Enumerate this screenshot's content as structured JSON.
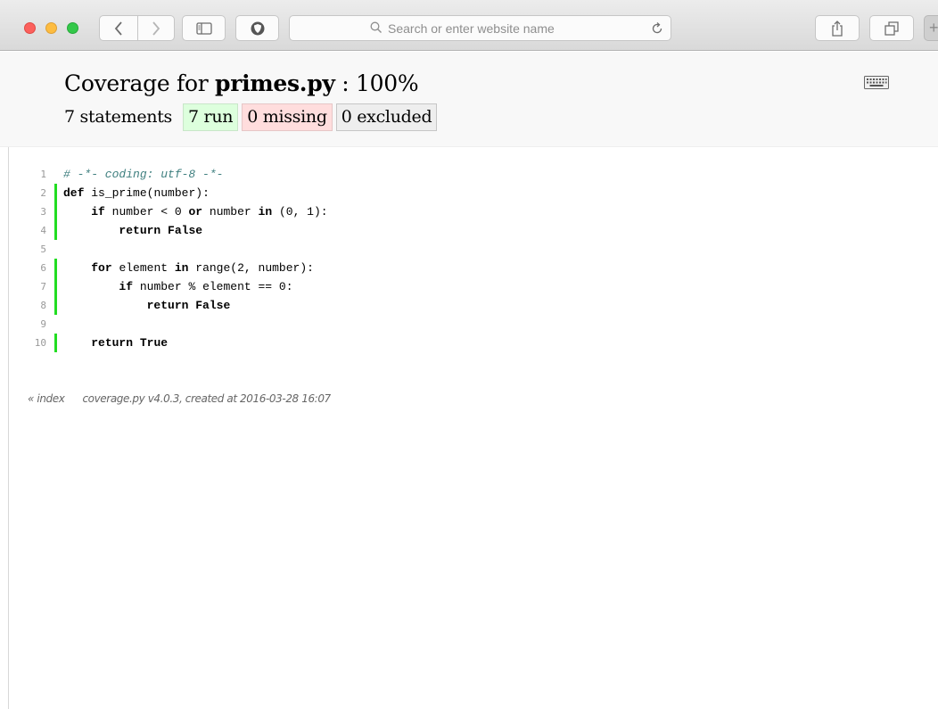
{
  "browser": {
    "address_placeholder": "Search or enter website name",
    "icons": {
      "back": "chevron-left-icon",
      "forward": "chevron-right-icon",
      "sidebar": "sidebar-icon",
      "shield": "shield-icon",
      "search": "search-icon",
      "reload": "reload-icon",
      "share": "share-icon",
      "tabs": "tabs-icon",
      "new_tab": "plus-icon"
    },
    "new_tab_label": "+"
  },
  "report": {
    "title_prefix": "Coverage for ",
    "filename": "primes.py",
    "title_suffix": " : 100%",
    "statements": "7 statements",
    "run": "7 run",
    "missing": "0 missing",
    "excluded": "0 excluded",
    "keyboard_icon": "keyboard-icon"
  },
  "source": {
    "lines": [
      {
        "n": "1",
        "status": "none",
        "text": "# -*- coding: utf-8 -*-"
      },
      {
        "n": "2",
        "status": "run",
        "text": "def is_prime(number):"
      },
      {
        "n": "3",
        "status": "run",
        "text": "    if number < 0 or number in (0, 1):"
      },
      {
        "n": "4",
        "status": "run",
        "text": "        return False"
      },
      {
        "n": "5",
        "status": "none",
        "text": ""
      },
      {
        "n": "6",
        "status": "run",
        "text": "    for element in range(2, number):"
      },
      {
        "n": "7",
        "status": "run",
        "text": "        if number % element == 0:"
      },
      {
        "n": "8",
        "status": "run",
        "text": "            return False"
      },
      {
        "n": "9",
        "status": "none",
        "text": ""
      },
      {
        "n": "10",
        "status": "run",
        "text": "    return True"
      }
    ]
  },
  "footer": {
    "index_link": "« index",
    "created": "coverage.py v4.0.3, created at 2016-03-28 16:07"
  },
  "colors": {
    "run_bar": "#22dd22",
    "run_bg": "#ddffdd",
    "missing_bg": "#ffdddd",
    "excluded_bg": "#eeeeee",
    "comment": "#408080"
  }
}
